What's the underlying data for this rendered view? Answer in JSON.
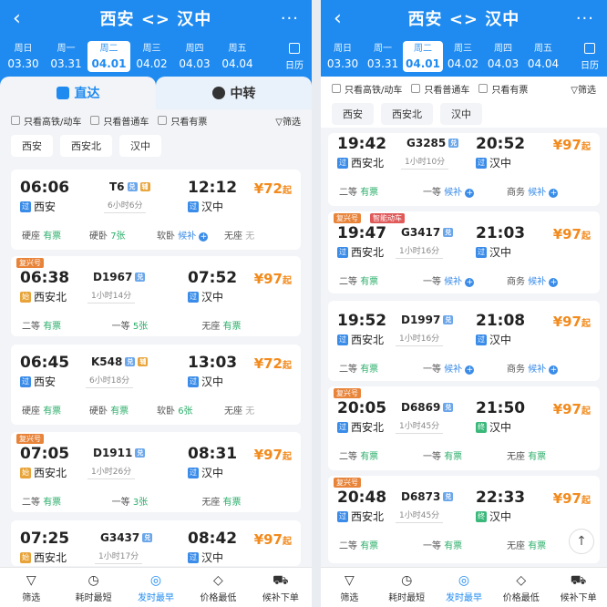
{
  "header": {
    "back": "‹",
    "title": "西安 <> 汉中",
    "more": "···"
  },
  "dates": [
    {
      "wk": "周日",
      "d": "03.30"
    },
    {
      "wk": "周一",
      "d": "03.31"
    },
    {
      "wk": "周二",
      "d": "04.01"
    },
    {
      "wk": "周三",
      "d": "04.02"
    },
    {
      "wk": "周四",
      "d": "04.03"
    },
    {
      "wk": "周五",
      "d": "04.04"
    }
  ],
  "calendar": "日历",
  "tabs": {
    "direct": "直达",
    "transfer": "中转"
  },
  "filters": {
    "hsr": "只看高铁/动车",
    "normal": "只看普通车",
    "avail": "只看有票",
    "sift": "筛选"
  },
  "stations": [
    "西安",
    "西安北",
    "汉中"
  ],
  "badges": {
    "pass": "过",
    "start": "始",
    "end": "终",
    "dui": "兑",
    "fu": "辅",
    "fuxing": "复兴号",
    "smart": "智能动车"
  },
  "left": [
    {
      "dep": "06:06",
      "from": "西安",
      "train": "T6",
      "dur": "6小时6分",
      "arr": "12:12",
      "to": "汉中",
      "price": "¥72",
      "seats": [
        [
          "硬座",
          "有票"
        ],
        [
          "硬卧",
          "7张"
        ],
        [
          "软卧",
          "候补"
        ],
        [
          "无座",
          "无"
        ]
      ]
    },
    {
      "dep": "06:38",
      "from": "西安北",
      "train": "D1967",
      "dur": "1小时14分",
      "arr": "07:52",
      "to": "汉中",
      "price": "¥97",
      "seats": [
        [
          "二等",
          "有票"
        ],
        [
          "一等",
          "5张"
        ],
        [
          "无座",
          "有票"
        ]
      ]
    },
    {
      "dep": "06:45",
      "from": "西安",
      "train": "K548",
      "dur": "6小时18分",
      "arr": "13:03",
      "to": "汉中",
      "price": "¥72",
      "seats": [
        [
          "硬座",
          "有票"
        ],
        [
          "硬卧",
          "有票"
        ],
        [
          "软卧",
          "6张"
        ],
        [
          "无座",
          "无"
        ]
      ]
    },
    {
      "dep": "07:05",
      "from": "西安北",
      "train": "D1911",
      "dur": "1小时26分",
      "arr": "08:31",
      "to": "汉中",
      "price": "¥97",
      "seats": [
        [
          "二等",
          "有票"
        ],
        [
          "一等",
          "3张"
        ],
        [
          "无座",
          "有票"
        ]
      ]
    },
    {
      "dep": "07:25",
      "from": "西安北",
      "train": "G3437",
      "dur": "1小时17分",
      "arr": "08:42",
      "to": "汉中",
      "price": "¥97"
    }
  ],
  "right": [
    {
      "dep": "19:42",
      "from": "西安北",
      "train": "G3285",
      "dur": "1小时10分",
      "arr": "20:52",
      "to": "汉中",
      "price": "¥97",
      "seats": [
        [
          "二等",
          "有票"
        ],
        [
          "一等",
          "候补"
        ],
        [
          "商务",
          "候补"
        ]
      ]
    },
    {
      "dep": "19:47",
      "from": "西安北",
      "train": "G3417",
      "dur": "1小时16分",
      "arr": "21:03",
      "to": "汉中",
      "price": "¥97",
      "seats": [
        [
          "二等",
          "有票"
        ],
        [
          "一等",
          "候补"
        ],
        [
          "商务",
          "候补"
        ]
      ]
    },
    {
      "dep": "19:52",
      "from": "西安北",
      "train": "D1997",
      "dur": "1小时16分",
      "arr": "21:08",
      "to": "汉中",
      "price": "¥97",
      "seats": [
        [
          "二等",
          "有票"
        ],
        [
          "一等",
          "候补"
        ],
        [
          "商务",
          "候补"
        ]
      ]
    },
    {
      "dep": "20:05",
      "from": "西安北",
      "train": "D6869",
      "dur": "1小时45分",
      "arr": "21:50",
      "to": "汉中",
      "price": "¥97",
      "seats": [
        [
          "二等",
          "有票"
        ],
        [
          "一等",
          "有票"
        ],
        [
          "无座",
          "有票"
        ]
      ]
    },
    {
      "dep": "20:48",
      "from": "西安北",
      "train": "D6873",
      "dur": "1小时45分",
      "arr": "22:33",
      "to": "汉中",
      "price": "¥97",
      "seats": [
        [
          "二等",
          "有票"
        ],
        [
          "一等",
          "有票"
        ],
        [
          "无座",
          "有票"
        ]
      ]
    }
  ],
  "priceSuffix": "起",
  "bottom": [
    "筛选",
    "耗时最短",
    "发时最早",
    "价格最低",
    "候补下单"
  ]
}
